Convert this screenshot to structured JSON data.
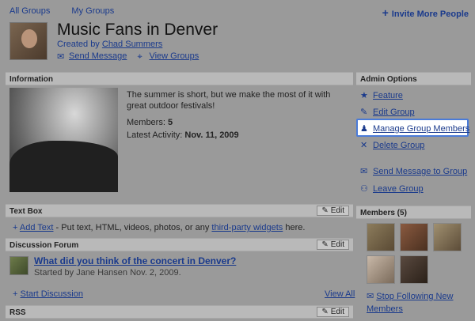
{
  "topnav": {
    "all_groups": "All Groups",
    "my_groups": "My Groups"
  },
  "invite": {
    "label": "Invite More People"
  },
  "group": {
    "title": "Music Fans in Denver",
    "created_prefix": "Created by ",
    "created_by": "Chad Summers",
    "send_message": "Send Message",
    "view_groups": "View Groups"
  },
  "information": {
    "header": "Information",
    "description": "The summer is short, but we make the most of it with great outdoor festivals!",
    "members_label": "Members: ",
    "members_value": "5",
    "activity_label": "Latest Activity: ",
    "activity_value": "Nov. 11, 2009"
  },
  "admin": {
    "header": "Admin Options",
    "feature": "Feature",
    "edit_group": "Edit Group",
    "manage_members": "Manage Group Members",
    "delete_group": "Delete Group",
    "send_message_group": "Send Message to Group",
    "leave_group": "Leave Group"
  },
  "textbox": {
    "header": "Text Box",
    "edit": "Edit",
    "add_text": "Add Text",
    "desc_mid": " - Put text, HTML, videos, photos, or any ",
    "widgets_link": "third-party widgets",
    "desc_end": " here."
  },
  "discussion": {
    "header": "Discussion Forum",
    "edit": "Edit",
    "topic": "What did you think of the concert in Denver?",
    "started_by": "Started by Jane Hansen Nov. 2, 2009.",
    "start_discussion": "Start Discussion",
    "view_all": "View All"
  },
  "members_box": {
    "header": "Members (5)",
    "stop_following_1": "Stop Following New",
    "stop_following_2": "Members"
  },
  "rss": {
    "header": "RSS",
    "edit": "Edit"
  },
  "colors": {
    "link": "#1a3a8c",
    "highlight_border": "#4a7bd8"
  }
}
